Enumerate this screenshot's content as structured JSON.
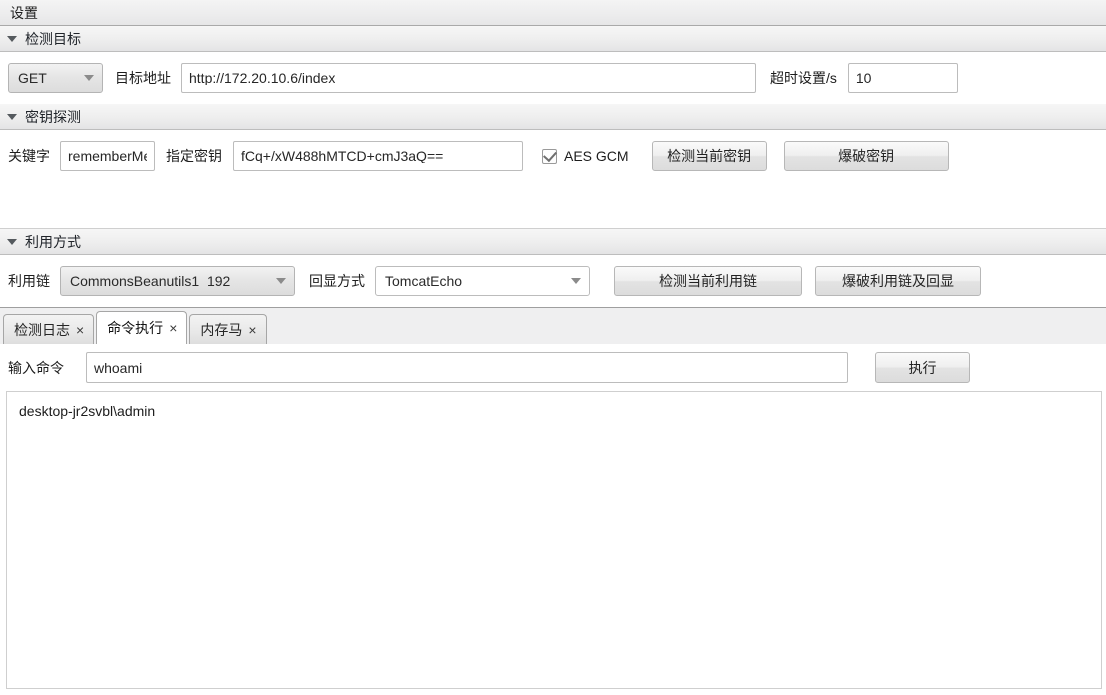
{
  "titlebar": {
    "title": "设置"
  },
  "sections": {
    "target": {
      "header": "检测目标",
      "method_value": "GET",
      "url_label": "目标地址",
      "url_value": "http://172.20.10.6/index",
      "timeout_label": "超时设置/s",
      "timeout_value": "10"
    },
    "key_probe": {
      "header": "密钥探测",
      "keyword_label": "关键字",
      "keyword_value": "rememberMe",
      "key_label": "指定密钥",
      "key_value": "fCq+/xW488hMTCD+cmJ3aQ==",
      "aes_checkbox_label": "AES GCM",
      "aes_checkbox_checked": true,
      "detect_key_button": "检测当前密钥",
      "brute_key_button": "爆破密钥"
    },
    "exploit": {
      "header": "利用方式",
      "chain_label": "利用链",
      "chain_value": "CommonsBeanutils1_192",
      "echo_label": "回显方式",
      "echo_value": "TomcatEcho",
      "detect_chain_button": "检测当前利用链",
      "brute_chain_button": "爆破利用链及回显"
    }
  },
  "tabs": [
    {
      "label": "检测日志",
      "close": "×",
      "active": false
    },
    {
      "label": "命令执行",
      "close": "×",
      "active": true
    },
    {
      "label": "内存马",
      "close": "×",
      "active": false
    }
  ],
  "command_panel": {
    "input_label": "输入命令",
    "input_value": "whoami",
    "execute_button": "执行",
    "output_text": "desktop-jr2svbl\\admin"
  },
  "colors": {
    "window_bg": "#ffffff",
    "chrome_bg": "#eceded",
    "border": "#bdbdbd",
    "text": "#1c1c1c",
    "tab_active_bg": "#ffffff"
  }
}
